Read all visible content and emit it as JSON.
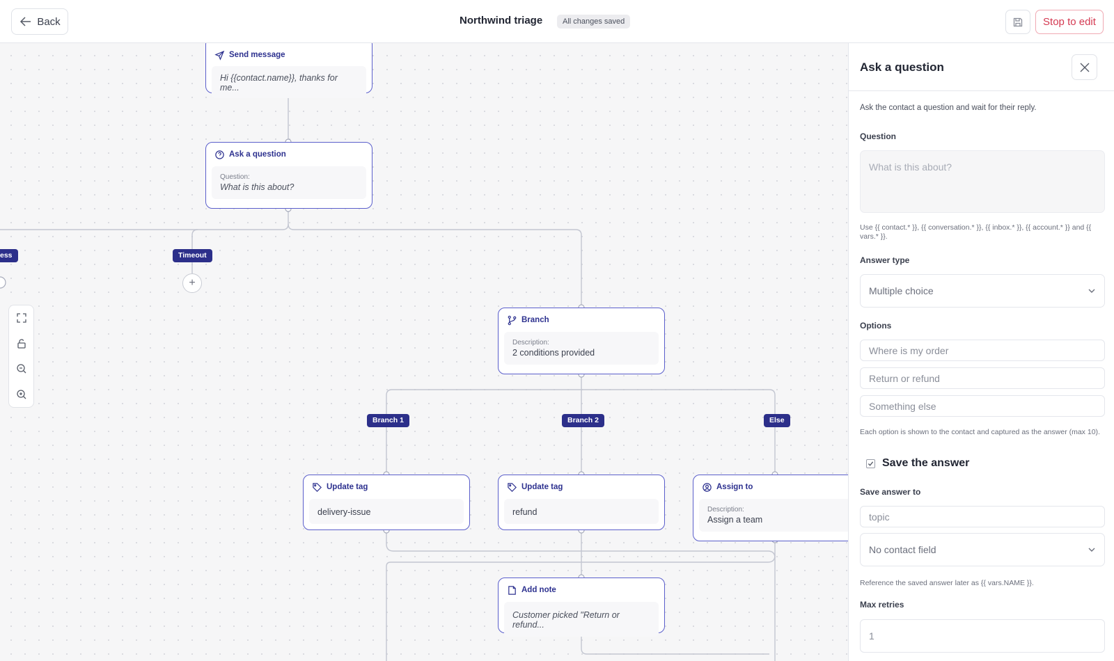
{
  "header": {
    "back_label": "Back",
    "title": "Northwind triage",
    "status_badge": "All changes saved",
    "stop_label": "Stop to edit"
  },
  "canvas": {
    "nodes": {
      "send_message": {
        "title": "Send message",
        "preview": "Hi {{contact.name}}, thanks for me..."
      },
      "ask_question": {
        "title": "Ask a question",
        "label": "Question:",
        "value": "What is this about?"
      },
      "branch": {
        "title": "Branch",
        "label": "Description:",
        "value": "2 conditions provided"
      },
      "update_tag_1": {
        "title": "Update tag",
        "value": "delivery-issue"
      },
      "update_tag_2": {
        "title": "Update tag",
        "value": "refund"
      },
      "assign_to": {
        "title": "Assign to",
        "label": "Description:",
        "value": "Assign a team"
      },
      "add_note": {
        "title": "Add note",
        "value": "Customer picked \"Return or refund..."
      }
    },
    "edge_labels": {
      "success": "ess",
      "timeout": "Timeout",
      "branch_1": "Branch 1",
      "branch_2": "Branch 2",
      "else": "Else"
    }
  },
  "panel": {
    "title": "Ask a question",
    "description": "Ask the contact a question and wait for their reply.",
    "question_label": "Question",
    "question_placeholder": "What is this about?",
    "variables_hint": "Use {{ contact.* }}, {{ conversation.* }}, {{ inbox.* }}, {{ account.* }} and {{ vars.* }}.",
    "answer_type_label": "Answer type",
    "answer_type_value": "Multiple choice",
    "options_label": "Options",
    "options": [
      "Where is my order",
      "Return or refund",
      "Something else"
    ],
    "options_hint": "Each option is shown to the contact and captured as the answer (max 10).",
    "save_answer_label": "Save the answer",
    "save_answer_checked": true,
    "save_to_label": "Save answer to",
    "save_to_value": "topic",
    "contact_field_value": "No contact field",
    "reference_hint": "Reference the saved answer later as {{ vars.NAME }}.",
    "max_retries_label": "Max retries",
    "max_retries_value": "1"
  },
  "colors": {
    "node_border": "#5a5ecb",
    "tag_bg": "#2c2f8a",
    "stop_button": "#d43951"
  }
}
